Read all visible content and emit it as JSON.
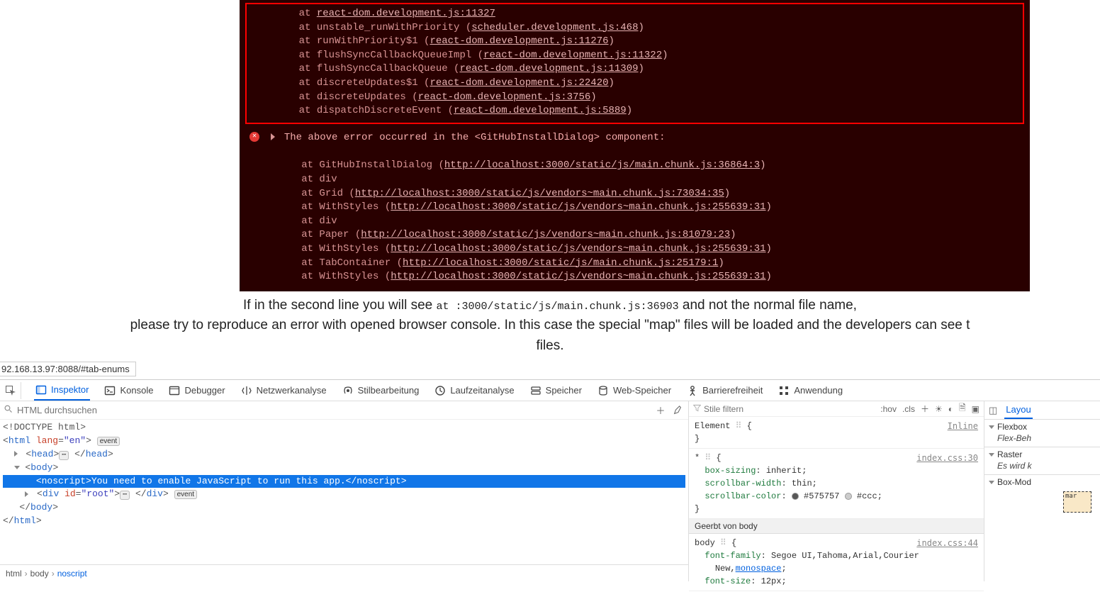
{
  "console": {
    "boxed_stack": [
      {
        "at": "at ",
        "link": "react-dom.development.js:11327"
      },
      {
        "at": "at unstable_runWithPriority (",
        "link": "scheduler.development.js:468",
        "suffix": ")"
      },
      {
        "at": "at runWithPriority$1 (",
        "link": "react-dom.development.js:11276",
        "suffix": ")"
      },
      {
        "at": "at flushSyncCallbackQueueImpl (",
        "link": "react-dom.development.js:11322",
        "suffix": ")"
      },
      {
        "at": "at flushSyncCallbackQueue (",
        "link": "react-dom.development.js:11309",
        "suffix": ")"
      },
      {
        "at": "at discreteUpdates$1 (",
        "link": "react-dom.development.js:22420",
        "suffix": ")"
      },
      {
        "at": "at discreteUpdates (",
        "link": "react-dom.development.js:3756",
        "suffix": ")"
      },
      {
        "at": "at dispatchDiscreteEvent (",
        "link": "react-dom.development.js:5889",
        "suffix": ")"
      }
    ],
    "summary": "The above error occurred in the <GitHubInstallDialog> component:",
    "stack2": [
      {
        "at": "at GitHubInstallDialog (",
        "link": "http://localhost:3000/static/js/main.chunk.js:36864:3",
        "suffix": ")"
      },
      {
        "at": "at div"
      },
      {
        "at": "at Grid (",
        "link": "http://localhost:3000/static/js/vendors~main.chunk.js:73034:35",
        "suffix": ")"
      },
      {
        "at": "at WithStyles (",
        "link": "http://localhost:3000/static/js/vendors~main.chunk.js:255639:31",
        "suffix": ")"
      },
      {
        "at": "at div"
      },
      {
        "at": "at Paper (",
        "link": "http://localhost:3000/static/js/vendors~main.chunk.js:81079:23",
        "suffix": ")"
      },
      {
        "at": "at WithStyles (",
        "link": "http://localhost:3000/static/js/vendors~main.chunk.js:255639:31",
        "suffix": ")"
      },
      {
        "at": "at TabContainer (",
        "link": "http://localhost:3000/static/js/main.chunk.js:25179:1",
        "suffix": ")"
      },
      {
        "at": "at WithStyles (",
        "link": "http://localhost:3000/static/js/vendors~main.chunk.js:255639:31",
        "suffix": ")"
      }
    ]
  },
  "instructions": {
    "line1_a": "If in the second line you will see ",
    "line1_code": "at :3000/static/js/main.chunk.js:36903",
    "line1_b": " and not the normal file name,",
    "line2": "please try to reproduce an error with opened browser console. In this case the special \"map\" files will be loaded and the developers can see t",
    "line3": "files."
  },
  "url_fragment": "92.168.13.97:8088/#tab-enums",
  "devtools": {
    "tabs": [
      "Inspektor",
      "Konsole",
      "Debugger",
      "Netzwerkanalyse",
      "Stilbearbeitung",
      "Laufzeitanalyse",
      "Speicher",
      "Web-Speicher",
      "Barrierefreiheit",
      "Anwendung"
    ],
    "active_tab_index": 0,
    "search_placeholder": "HTML durchsuchen",
    "dom": {
      "doctype": "<!DOCTYPE html>",
      "html_open_a": "<",
      "html_tag": "html",
      "lang_attr": "lang",
      "lang_val": "\"en\"",
      "html_close": ">",
      "event_badge": "event",
      "head_open": "<",
      "head_tag": "head",
      "head_close": "</head>",
      "body_tag": "body",
      "noscript_line": "<noscript>You need to enable JavaScript to run this app.</noscript>",
      "div_tag": "div",
      "id_attr": "id",
      "id_val": "\"root\"",
      "div_close": "</div>",
      "body_close": "</body>",
      "html_close_tag": "</html>"
    },
    "breadcrumb": [
      "html",
      "body",
      "noscript"
    ]
  },
  "styles": {
    "filter_placeholder": "Stile filtern",
    "hov": ":hov",
    "cls": ".cls",
    "element_label": "Element",
    "inline_label": "Inline",
    "universal_src": "index.css:30",
    "universal_rules": [
      {
        "p": "box-sizing",
        "v": "inherit"
      },
      {
        "p": "scrollbar-width",
        "v": "thin"
      },
      {
        "p": "scrollbar-color",
        "swatch1": "#575757",
        "swatch2": "#ccc"
      }
    ],
    "inherited_label": "Geerbt von body",
    "body_src": "index.css:44",
    "body_font_family_a": "Segoe UI,Tahoma,Arial,Courier",
    "body_font_family_b": "New,",
    "body_font_family_link": "monospace",
    "body_font_size": "12px"
  },
  "right": {
    "layout_tab": "Layou",
    "flexbox_h": "Flexbox",
    "flexbox_body": "Flex-Beh",
    "raster_h": "Raster",
    "raster_body": "Es wird k",
    "boxmodel_h": "Box-Mod",
    "boxmodel_label": "mar"
  }
}
